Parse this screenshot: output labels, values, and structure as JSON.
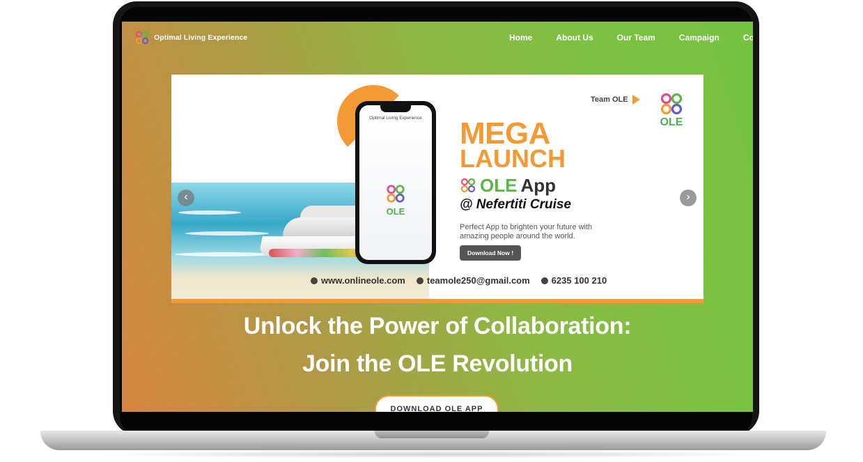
{
  "nav": {
    "brand": "Optimal Living Experience",
    "links": [
      "Home",
      "About Us",
      "Our Team",
      "Campaign",
      "Co"
    ]
  },
  "banner": {
    "team_label": "Team OLE",
    "logo_text": "OLE",
    "phone_title": "Optimal Living Experience",
    "phone_logo_text": "OLE",
    "mega": "MEGA",
    "launch": "LAUNCH",
    "ole_word": "OLE",
    "app_word": "App",
    "cruise": "@ Nefertiti Cruise",
    "tagline": "Perfect App to brighten your future with amazing people around the world.",
    "download_small": "Download Now !",
    "website": "www.onlineole.com",
    "email": "teamole250@gmail.com",
    "phone": "6235 100 210",
    "prev_arrow": "‹",
    "next_arrow": "›"
  },
  "hero": {
    "line1": "Unlock the Power of Collaboration:",
    "line2": "Join the OLE Revolution",
    "cta": "DOWNLOAD OLE APP"
  },
  "colors": {
    "accent_orange": "#f39a34",
    "brand_green": "#5bb848",
    "gradient_start": "#d6853e",
    "gradient_end": "#77c241"
  },
  "icons": [
    "ole-logo-icon",
    "globe-icon",
    "mail-icon",
    "phone-icon",
    "chevron-left-icon",
    "chevron-right-icon",
    "play-triangle-icon"
  ]
}
